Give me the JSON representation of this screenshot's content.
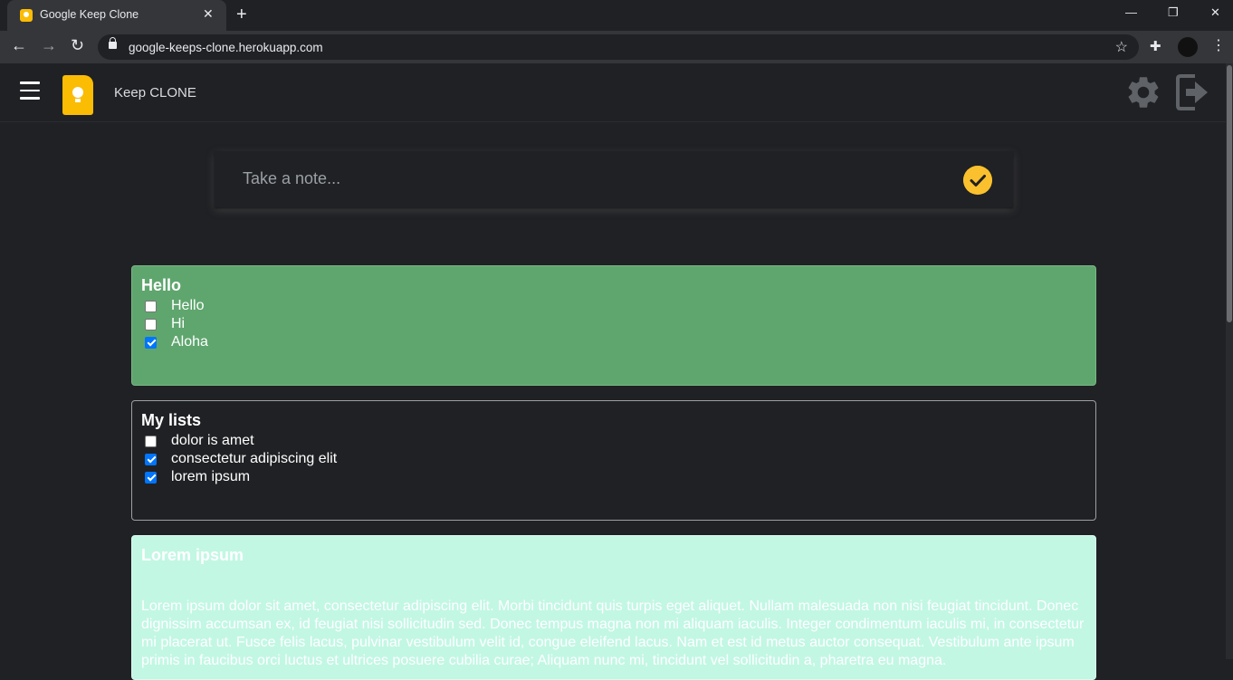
{
  "browser": {
    "tab_title": "Google Keep Clone",
    "tab_close": "✕",
    "new_tab": "+",
    "url": "google-keeps-clone.herokuapp.com",
    "window_controls": {
      "minimize": "—",
      "restore": "❐",
      "close": "✕"
    },
    "nav": {
      "back": "←",
      "forward": "→",
      "reload": "↻"
    },
    "star": "☆",
    "extensions": "✚",
    "menu": "⋮"
  },
  "header": {
    "title": "Keep CLONE",
    "icons": [
      "hamburger-icon",
      "keep-logo-icon",
      "gear-icon",
      "logout-icon"
    ]
  },
  "note_input": {
    "placeholder": "Take a note..."
  },
  "notes": [
    {
      "title": "Hello",
      "color": "#5fa66e",
      "items": [
        {
          "label": "Hello",
          "checked": false
        },
        {
          "label": "Hi",
          "checked": false
        },
        {
          "label": "Aloha",
          "checked": true
        }
      ]
    },
    {
      "title": "My lists",
      "color": "#202124",
      "items": [
        {
          "label": "dolor is amet",
          "checked": false
        },
        {
          "label": "consectetur adipiscing elit",
          "checked": true
        },
        {
          "label": "lorem ipsum",
          "checked": true
        }
      ]
    },
    {
      "title": "Lorem ipsum",
      "color": "#c2f7e4",
      "text": "Lorem ipsum dolor sit amet, consectetur adipiscing elit. Morbi tincidunt quis turpis eget aliquet. Nullam malesuada non nisi feugiat tincidunt. Donec dignissim accumsan ex, id feugiat nisi sollicitudin sed. Donec tempus magna non mi aliquam iaculis. Integer condimentum iaculis mi, in consectetur mi placerat ut. Fusce felis lacus, pulvinar vestibulum velit id, congue eleifend lacus. Nam et est id metus auctor consequat. Vestibulum ante ipsum primis in faucibus orci luctus et ultrices posuere cubilia curae; Aliquam nunc mi, tincidunt vel sollicitudin a, pharetra eu magna."
    }
  ],
  "colors": {
    "accent": "#fbc02d",
    "checkbox": "#0075ff"
  }
}
